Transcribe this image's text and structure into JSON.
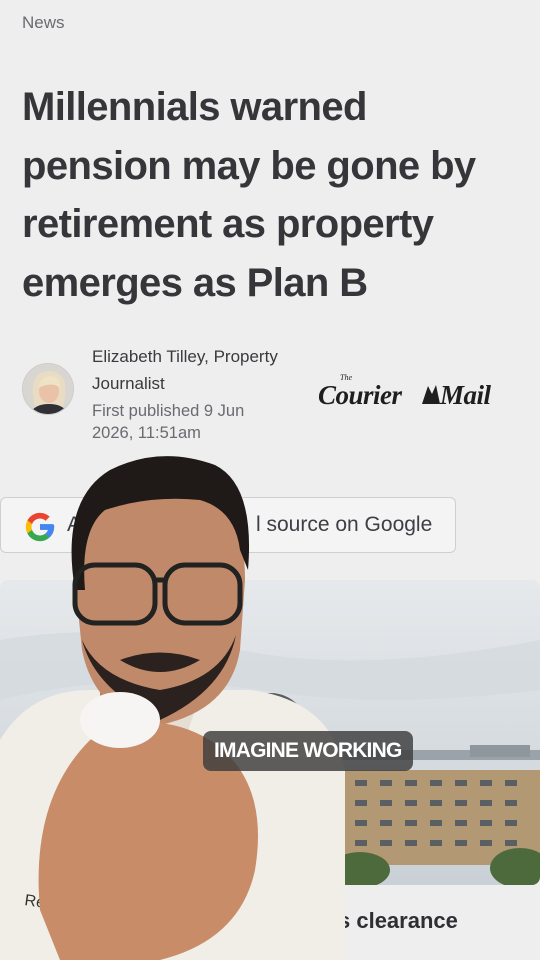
{
  "header": {
    "section": "News"
  },
  "article": {
    "headline_lines": [
      "Millennials warned",
      "pension may be gone by",
      "retirement as property",
      "emerges as Plan B"
    ],
    "author_line1": "Elizabeth Tilley, Property",
    "author_line2": "Journalist",
    "published_line1": "First published 9 Jun",
    "published_line2": "2026, 11:51am",
    "publisher_logo_text": "Courier Mail",
    "google_pill_text_left": "A",
    "google_pill_text_right": "l source on Google",
    "subhead_partial": "s clearance"
  },
  "video": {
    "caption": "IMAGINE WORKING",
    "hoodie_text": "Research"
  },
  "colors": {
    "page_bg": "#eeeeee",
    "headline": "#36363a",
    "caption_bg": "#3c3c3c",
    "google_blue": "#4285F4",
    "google_red": "#EA4335",
    "google_yellow": "#FBBC05",
    "google_green": "#34A853"
  },
  "icons": {
    "google_logo": "google-g-icon",
    "play": "play-icon"
  }
}
